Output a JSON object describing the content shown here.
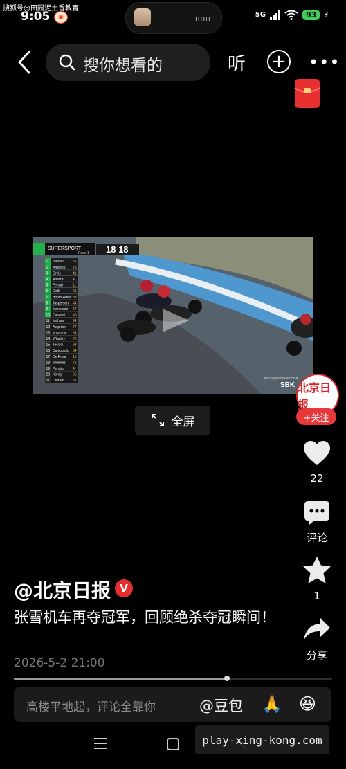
{
  "watermark_top": "搜狐号@田园泥土香教育",
  "status": {
    "time": "9:05",
    "network": "5G",
    "battery": "93"
  },
  "header": {
    "search_placeholder": "搜你想看的",
    "listen_label": "听"
  },
  "video": {
    "overlay_title": "SUPERSPORT",
    "overlay_subtitle": "Race 1",
    "lap": "18 18",
    "broadcast_tag": "#HungarianWorldSBK",
    "broadcast_logo": "SBK",
    "leaderboard": [
      {
        "pos": "1",
        "name": "Stefani",
        "num": "55"
      },
      {
        "pos": "2",
        "name": "Arbolino",
        "num": "78"
      },
      {
        "pos": "3",
        "name": "Orvis",
        "num": "41"
      },
      {
        "pos": "4",
        "name": "Arrizza",
        "num": "4"
      },
      {
        "pos": "5",
        "name": "Ferrari",
        "num": "11"
      },
      {
        "pos": "6",
        "name": "Oettl",
        "num": "61"
      },
      {
        "pos": "7",
        "name": "Booth-Amos",
        "num": "88"
      },
      {
        "pos": "8",
        "name": "Jaspersen",
        "num": "44"
      },
      {
        "pos": "9",
        "name": "Manoorzo",
        "num": "57"
      },
      {
        "pos": "10",
        "name": "Casadei",
        "num": "40"
      },
      {
        "pos": "11",
        "name": "Mahias",
        "num": "94"
      },
      {
        "pos": "12",
        "name": "Aegerter",
        "num": "77"
      },
      {
        "pos": "13",
        "name": "Vostratia",
        "num": "64"
      },
      {
        "pos": "14",
        "name": "Whatley",
        "num": "70"
      },
      {
        "pos": "15",
        "name": "Teccloi",
        "num": "93"
      },
      {
        "pos": "16",
        "name": "Caricasulo",
        "num": "64"
      },
      {
        "pos": "17",
        "name": "De Rosa",
        "num": "15"
      },
      {
        "pos": "18",
        "name": "Jimenez",
        "num": "71"
      },
      {
        "pos": "19",
        "name": "Perolari",
        "num": "4"
      },
      {
        "pos": "20",
        "name": "Konig",
        "num": "96"
      },
      {
        "pos": "21",
        "name": "Cretaro",
        "num": "51"
      }
    ]
  },
  "fullscreen_label": "全屏",
  "sidebar": {
    "avatar_text": "北京日报",
    "follow_label": "+关注",
    "like_count": "22",
    "comment_label": "评论",
    "favorite_count": "1",
    "share_label": "分享"
  },
  "post": {
    "author": "@北京日报",
    "verified_mark": "V",
    "caption": "张雪机车再夺冠军，回顾绝杀夺冠瞬间！",
    "time": "2026-5-2 21:00",
    "progress": 0.67
  },
  "comment_bar": {
    "placeholder": "高楼平地起，评论全靠你",
    "doubao": "@豆包",
    "emoji_1": "🙏",
    "emoji_2": "😆"
  },
  "watermark_bottom": "play-xing-kong.com",
  "colors": {
    "accent_red": "#e8383a",
    "battery_green": "#3ecf5a"
  }
}
